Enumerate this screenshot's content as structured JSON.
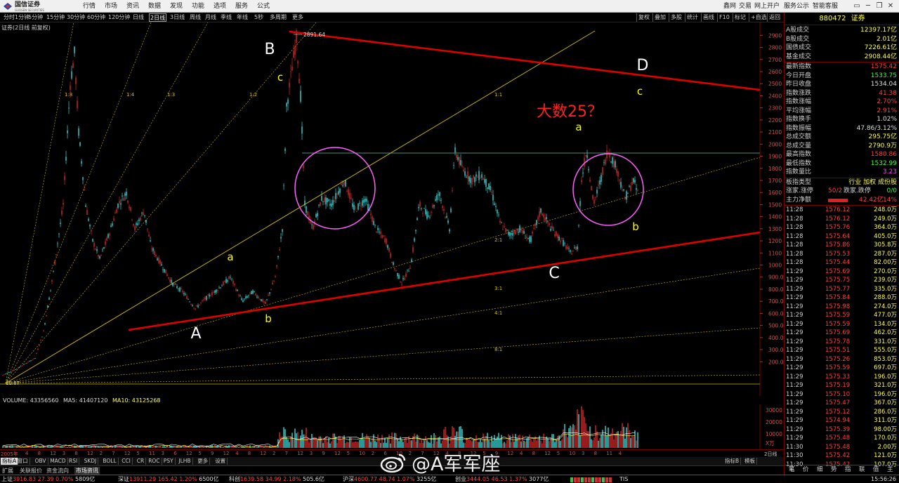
{
  "app": {
    "logo_name": "国信证券",
    "logo_sub": "GUOSEN SECURITIES",
    "menu": [
      "行情",
      "市场",
      "资讯",
      "数据",
      "发现",
      "功能",
      "选项",
      "服务",
      "公式"
    ],
    "menu_right": [
      "鑫网",
      "交易",
      "网上开户",
      "服务公示",
      "智能客服"
    ],
    "window_controls": [
      "▭",
      "─",
      "❐",
      "✕"
    ]
  },
  "toolbar": {
    "periods": [
      "分时",
      "1分钟",
      "5分钟",
      "15分钟",
      "30分钟",
      "60分钟",
      "120分钟",
      "日线",
      "2日线",
      "3日线",
      "周线",
      "月线",
      "季线",
      "年线",
      "5秒",
      "多周期",
      "更多"
    ],
    "active_period": "2日线",
    "right_items": [
      "复权",
      "叠加",
      "多股",
      "统计",
      "画线",
      "F10",
      "标记",
      "+自选",
      "返回"
    ]
  },
  "chart": {
    "caption": "证券(2日线 前复权)",
    "peak_label": "2891.64",
    "low_label": "11.07",
    "wave_labels": {
      "A": "A",
      "B": "B",
      "C": "C",
      "D": "D",
      "a1": "a",
      "b1": "b",
      "c1": "c",
      "a2": "a",
      "b2": "b",
      "c2": "c"
    },
    "question_text": "大数25？",
    "fan_labels": [
      "1:8",
      "1:4",
      "1:3",
      "1:2",
      "1:1",
      "2:1",
      "3:1",
      "4:1",
      "8:1"
    ],
    "y_axis_labels": [
      "2900",
      "2800",
      "2700",
      "2600",
      "2500",
      "2400",
      "2300",
      "2200",
      "2100",
      "2000",
      "1900",
      "1800",
      "1700",
      "1600",
      "1500",
      "1400",
      "1300",
      "1200",
      "1100",
      "1000",
      "900.0",
      "800.0",
      "700.0",
      "600.0",
      "500.0",
      "400.0",
      "300.0",
      "200.0"
    ],
    "colors": {
      "up": "#ff3030",
      "down": "#40ffff",
      "trend": "#e00000",
      "fan": "#d8c000",
      "circle": "#ff60ff",
      "label": "#ffff00"
    }
  },
  "volume": {
    "label": "VOLUME: 43356560",
    "ma5": "MA5: 41407120",
    "ma10": "MA10: 43125268",
    "y_axis_labels": [
      "30000",
      "20000",
      "10000",
      "X万"
    ]
  },
  "date_axis": {
    "year_label": "2005年",
    "ticks": [
      "4",
      "8",
      "12",
      "3",
      "8",
      "12",
      "2",
      "7",
      "12",
      "5",
      "11",
      "3",
      "6",
      "12",
      "5",
      "9",
      "12",
      "4",
      "8",
      "12",
      "2",
      "7",
      "12",
      "3",
      "9",
      "12",
      "5",
      "10",
      "2",
      "6",
      "10",
      "2",
      "7",
      "12",
      "4",
      "8",
      "12",
      "5",
      "9",
      "12",
      "4",
      "8",
      "12",
      "5",
      "10",
      "3",
      "8",
      "11",
      "4"
    ],
    "period_label": "2日线"
  },
  "indicator_tabs": [
    "指标A",
    "窗口",
    "OBV",
    "MACD",
    "RSI",
    "SKDJ",
    "BOLL",
    "CCI",
    "CR",
    "ROC",
    "PSY",
    "JLHB",
    "更多",
    "设置"
  ],
  "bottom_tabs": [
    "扩展",
    "关联报价",
    "资金流向",
    "市场资讯"
  ],
  "bottom_right": [
    "指标B",
    "模板"
  ],
  "statusbar": [
    {
      "name": "上证",
      "price": "3916.83",
      "chg": "27.39",
      "pct": "0.70%",
      "amt": "5809亿"
    },
    {
      "name": "深证",
      "price": "13911.29",
      "chg": "165.42",
      "pct": "1.20%",
      "amt": "6500亿"
    },
    {
      "name": "科创",
      "price": "1639.58",
      "chg": "34.99",
      "pct": "2.18%",
      "amt": "505.6亿"
    },
    {
      "name": "沪深",
      "price": "4600.77",
      "chg": "48.74",
      "pct": "1.07%",
      "amt": "3255亿"
    },
    {
      "name": "创业",
      "price": "3444.05",
      "chg": "46.53",
      "pct": "1.37%",
      "amt": "3077亿"
    }
  ],
  "status_right": {
    "tis": "TIS",
    "time": "15:56:26"
  },
  "right_panel": {
    "code": "880472",
    "name": "证券",
    "stats_top": [
      {
        "label": "A股成交",
        "value": "12397.17亿"
      },
      {
        "label": "B股成交",
        "value": "2.01亿"
      },
      {
        "label": "国债成交",
        "value": "7226.61亿"
      },
      {
        "label": "基金成交",
        "value": "2908.44亿"
      }
    ],
    "stats": [
      {
        "label": "最新指数",
        "value": "1575.42",
        "color": "#ff4040"
      },
      {
        "label": "今日开盘",
        "value": "1533.75",
        "color": "#40ff40"
      },
      {
        "label": "昨日收盘",
        "value": "1534.04",
        "color": "#dddddd"
      },
      {
        "label": "指数涨跌",
        "value": "41.38",
        "color": "#ff4040"
      },
      {
        "label": "指数涨幅",
        "value": "2.70%",
        "color": "#ff4040"
      },
      {
        "label": "平均涨幅",
        "value": "2.91%",
        "color": "#ff4040"
      },
      {
        "label": "指数换手",
        "value": "1.02%",
        "color": "#dddddd"
      },
      {
        "label": "指数振幅",
        "value": "47.86/3.12%",
        "color": "#dddddd"
      },
      {
        "label": "总成交额",
        "value": "295.75亿",
        "color": "#ffff40"
      },
      {
        "label": "总成交量",
        "value": "2790.9万",
        "color": "#ffff40"
      },
      {
        "label": "最高指数",
        "value": "1580.86",
        "color": "#ff4040"
      },
      {
        "label": "最低指数",
        "value": "1532.99",
        "color": "#40ff40"
      },
      {
        "label": "指数量比",
        "value": "3.23",
        "color": "#ff40ff"
      }
    ],
    "board_type_label": "板指类型",
    "board_type_value": "行业 加权 成份股",
    "updown_label": "涨家.涨停",
    "updown_value": "50/2",
    "down_label": "跌家.跌停",
    "down_value": "0/0",
    "netflow_label": "主力净额",
    "netflow_value": "42.42亿",
    "netflow_pct": "14%",
    "ticks": [
      [
        "11:28",
        "1576.12",
        "248.0万"
      ],
      [
        "11:28",
        "1576.12",
        "249.0万"
      ],
      [
        "11:28",
        "1575.76",
        "364.0万"
      ],
      [
        "11:28",
        "1575.64",
        "405.0万"
      ],
      [
        "11:28",
        "1575.86",
        "305.8万"
      ],
      [
        "11:28",
        "1575.53",
        "287.0万"
      ],
      [
        "11:28",
        "1575.44",
        "82.00万"
      ],
      [
        "11:29",
        "1575.69",
        "270.0万"
      ],
      [
        "11:29",
        "1575.75",
        "239.0万"
      ],
      [
        "11:29",
        "1575.77",
        "335.0万"
      ],
      [
        "11:29",
        "1575.84",
        "288.0万"
      ],
      [
        "11:29",
        "1575.98",
        "274.0万"
      ],
      [
        "11:29",
        "1575.59",
        "477.0万"
      ],
      [
        "11:29",
        "1575.59",
        "134.0万"
      ],
      [
        "11:29",
        "1575.69",
        "462.0万"
      ],
      [
        "11:29",
        "1575.78",
        "331.0万"
      ],
      [
        "11:29",
        "1575.51",
        "555.0万"
      ],
      [
        "11:29",
        "1575.26",
        "853.0万"
      ],
      [
        "11:29",
        "1575.59",
        "697.0万"
      ],
      [
        "11:29",
        "1575.33",
        "196.0万"
      ],
      [
        "11:29",
        "1575.19",
        "321.0万"
      ],
      [
        "11:29",
        "1575.10",
        "196.0万"
      ],
      [
        "11:29",
        "1575.47",
        "367.0万"
      ],
      [
        "11:29",
        "1575.12",
        "286.0万"
      ],
      [
        "11:29",
        "1574.94",
        "311.0万"
      ],
      [
        "11:29",
        "1575.39",
        "98.00万"
      ],
      [
        "11:29",
        "1575.48",
        "170.0万"
      ],
      [
        "11:30",
        "1575.48",
        "2.00万"
      ],
      [
        "11:30",
        "1575.42",
        "121.0万"
      ],
      [
        "11:30",
        "1575.42",
        "107.0万"
      ]
    ],
    "tabs": [
      "笔",
      "价",
      "细",
      "势",
      "指",
      "联",
      "值",
      "主"
    ]
  },
  "watermark": {
    "text": "@A军军座"
  }
}
